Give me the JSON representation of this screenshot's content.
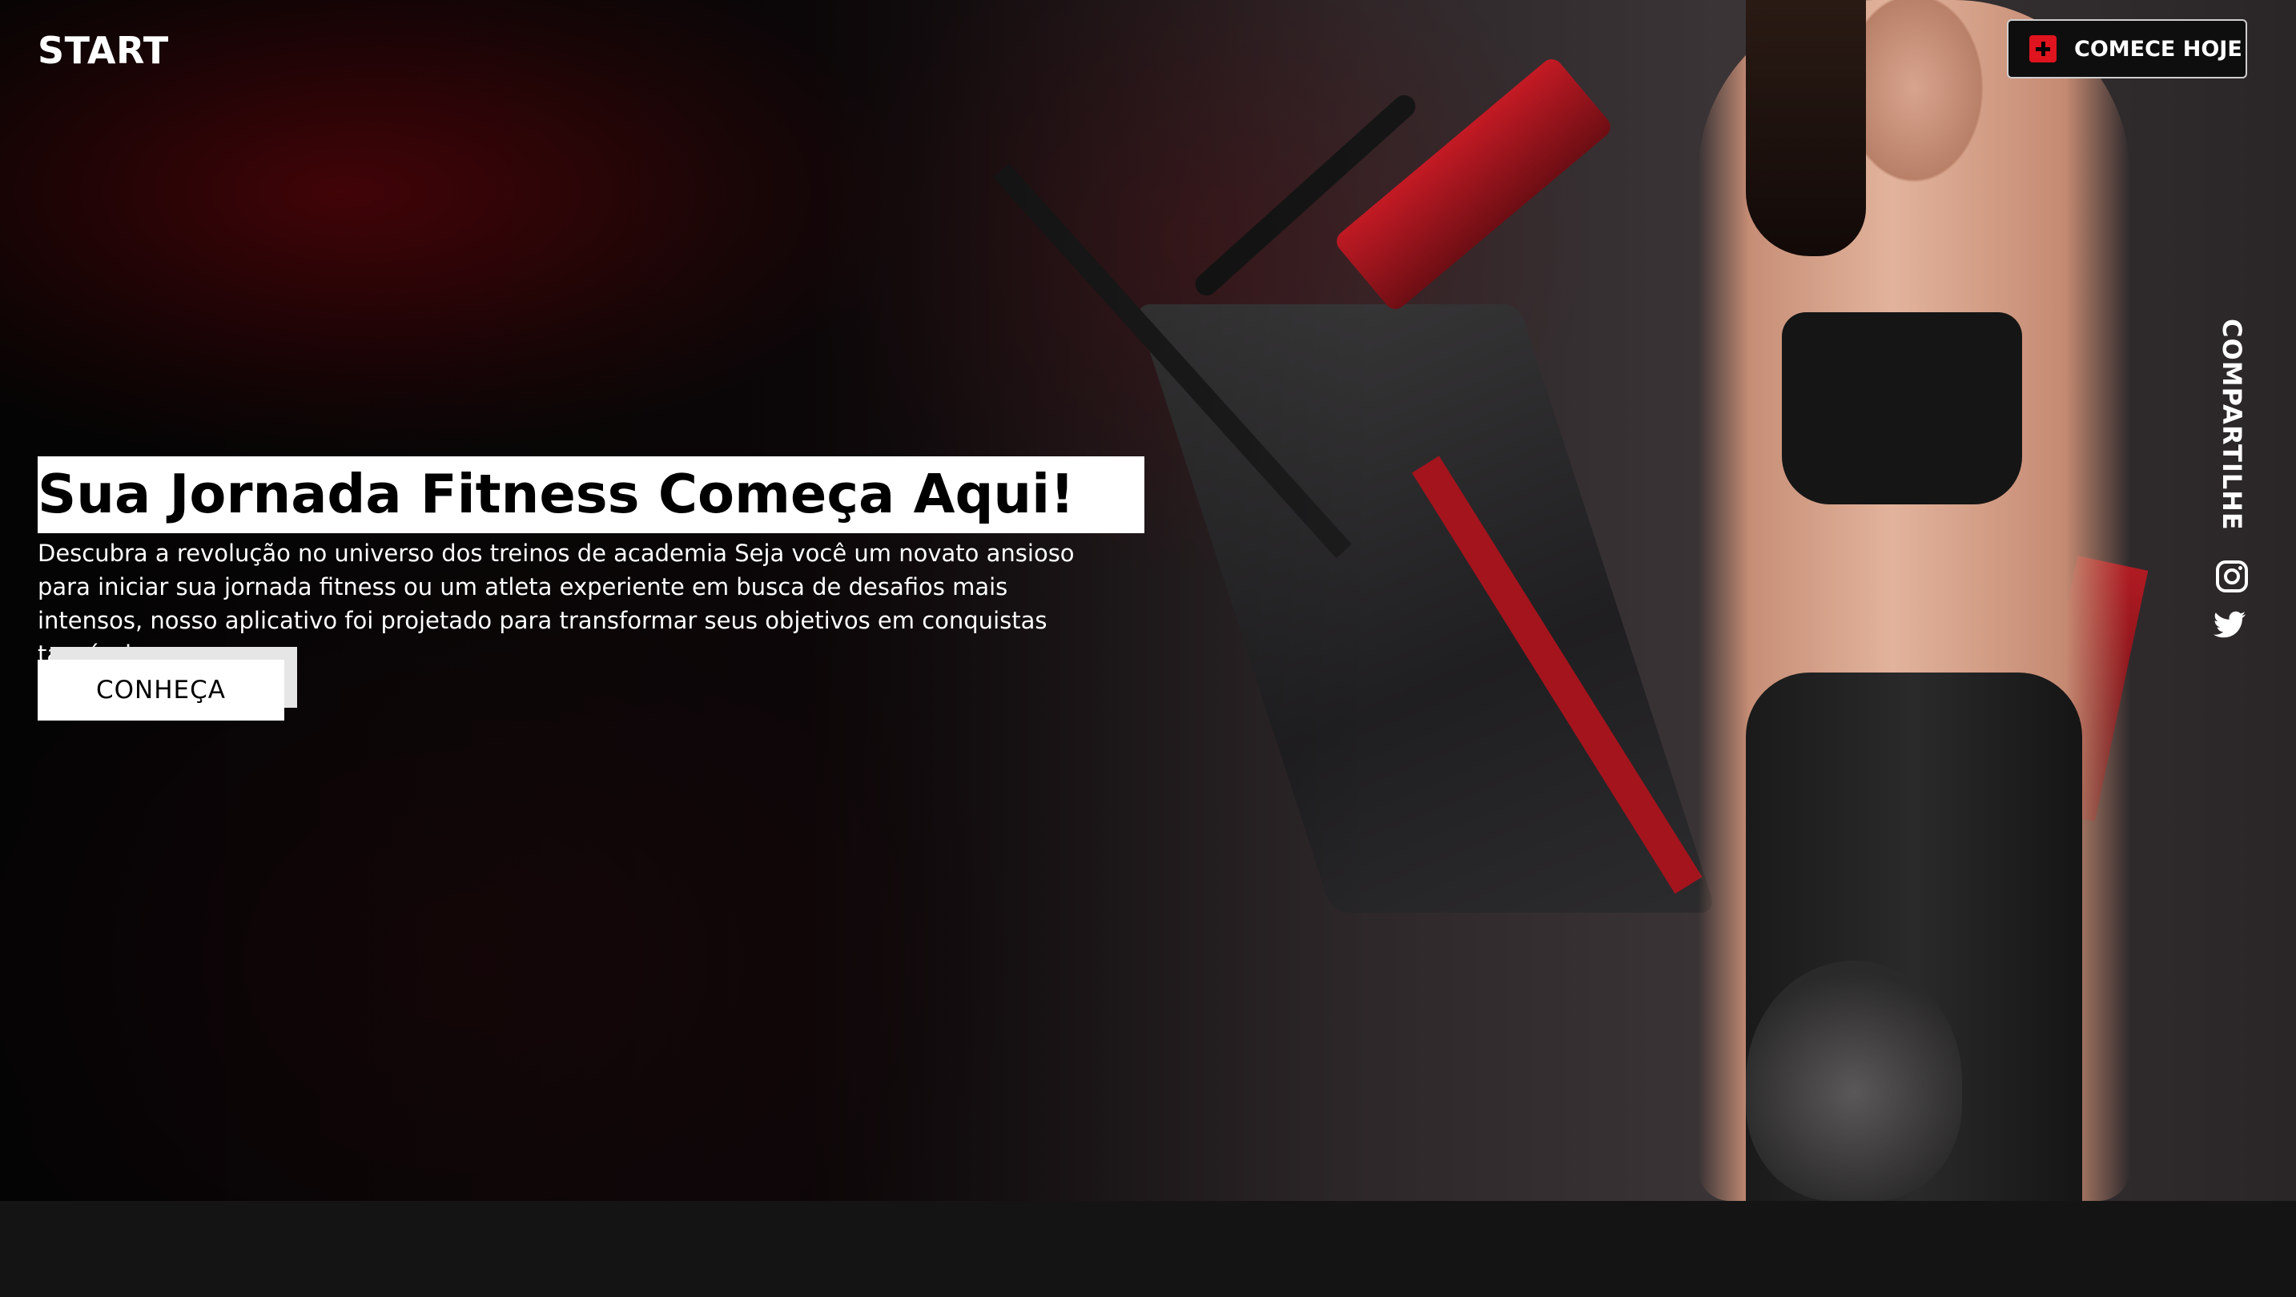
{
  "header": {
    "brand": "START",
    "cta_label": "COMECE HOJE",
    "cta_icon": "plus-square-icon"
  },
  "hero": {
    "title": "Sua Jornada Fitness Começa Aqui!",
    "description": "Descubra a revolução no universo dos treinos de academia Seja você um novato ansioso para iniciar sua jornada fitness ou um atleta experiente em busca de desafios mais intensos, nosso aplicativo foi projetado para transformar seus objetivos em conquistas tangíveis.",
    "button_label": "CONHEÇA"
  },
  "share": {
    "label": "COMPARTILHE",
    "icons": [
      "instagram-icon",
      "twitter-icon"
    ]
  },
  "colors": {
    "accent": "#e0141e",
    "background": "#141414",
    "text": "#ffffff"
  }
}
